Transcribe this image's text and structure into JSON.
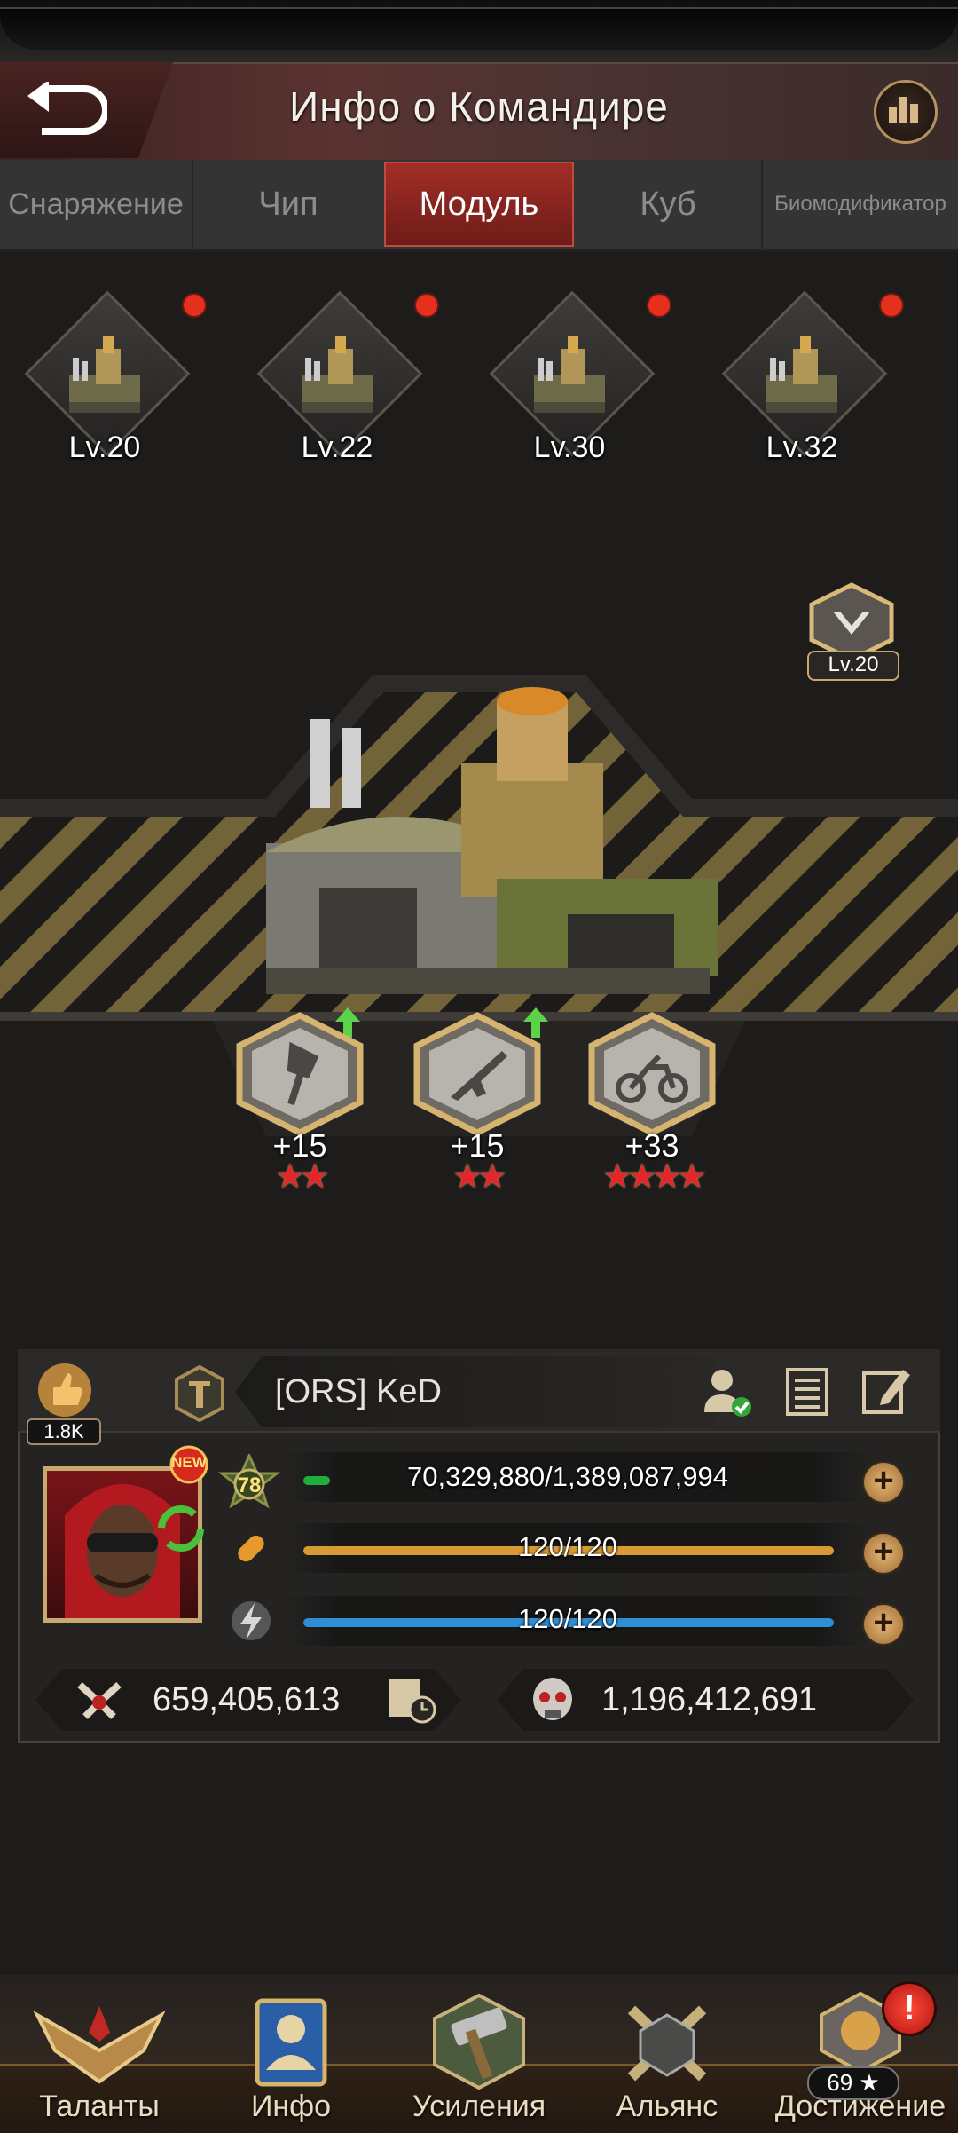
{
  "header": {
    "title": "Инфо о Командире"
  },
  "tabs": [
    {
      "label": "Снаряжение"
    },
    {
      "label": "Чип"
    },
    {
      "label": "Модуль",
      "active": true
    },
    {
      "label": "Куб"
    },
    {
      "label": "Биомодификатор"
    }
  ],
  "modules": [
    {
      "level": "Lv.20"
    },
    {
      "level": "Lv.22"
    },
    {
      "level": "Lv.30"
    },
    {
      "level": "Lv.32"
    }
  ],
  "rank_badge": {
    "level": "Lv.20"
  },
  "skills": [
    {
      "value": "+15",
      "stars": "★★",
      "icon": "axe-icon"
    },
    {
      "value": "+15",
      "stars": "★★",
      "icon": "rifle-icon"
    },
    {
      "value": "+33",
      "stars": "★★★★",
      "icon": "motorcycle-icon"
    }
  ],
  "commander": {
    "likes": "1.8K",
    "name": "[ORS]   KeD",
    "new_badge": "NEW",
    "level": "78",
    "exp": "70,329,880/1,389,087,994",
    "exp_fraction": 0.051,
    "stamina": "120/120",
    "energy": "120/120",
    "power": "659,405,613",
    "kills": "1,196,412,691"
  },
  "nav": [
    {
      "label": "Таланты"
    },
    {
      "label": "Инфо"
    },
    {
      "label": "Усиления"
    },
    {
      "label": "Альянс"
    },
    {
      "label": "Достижение"
    }
  ],
  "achievement_count": "69 ★",
  "colors": {
    "accent_red": "#a32d27",
    "gold": "#c9a66c",
    "exp_green": "#1fae3a",
    "stamina_orange": "#d89a35",
    "energy_blue": "#2f8fd6"
  }
}
